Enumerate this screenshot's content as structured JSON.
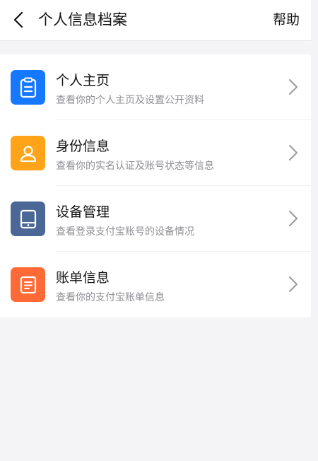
{
  "header": {
    "back_icon": "chevron-left-icon",
    "title": "个人信息档案",
    "help_label": "帮助"
  },
  "items": [
    {
      "title": "个人主页",
      "subtitle": "查看你的个人主页及设置公开资料",
      "icon": "clipboard-icon",
      "color": "#1677ff"
    },
    {
      "title": "身份信息",
      "subtitle": "查看你的实名认证及账号状态等信息",
      "icon": "person-icon",
      "color": "#ffa318"
    },
    {
      "title": "设备管理",
      "subtitle": "查看登录支付宝账号的设备情况",
      "icon": "tablet-icon",
      "color": "#4a6796"
    },
    {
      "title": "账单信息",
      "subtitle": "查看你的支付宝账单信息",
      "icon": "bill-icon",
      "color": "#ff6a36"
    }
  ],
  "colors": {
    "background": "#f4f4f6",
    "card": "#ffffff",
    "title_text": "#111111",
    "subtitle_text": "#8f8f94",
    "chevron": "#9a9a9f"
  }
}
